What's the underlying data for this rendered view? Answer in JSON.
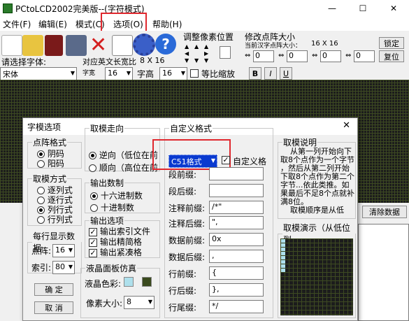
{
  "app": {
    "title": "PCtoLCD2002完美版--(字符模式)",
    "minimize": "—",
    "maximize": "☐",
    "close": "✕"
  },
  "menu": {
    "file": "文件(F)",
    "edit": "编辑(E)",
    "mode": "模式(C)",
    "options": "选项(O)",
    "help": "帮助(H)"
  },
  "toolbar": {
    "adjust_pixel": "调整像素位置",
    "resize_title": "修改点阵大小",
    "resize_sub": "当前汉字点阵大小：",
    "resize_size": "16  X  16",
    "lock": "锁定",
    "restore": "复位",
    "spin_a": "0",
    "spin_b": "0",
    "spin_c": "0",
    "spin_d": "0",
    "font_label": "请选择字体:",
    "font_value": "宋体",
    "en_width_label": "对应英文长宽比",
    "en_width_value": "8 X 16",
    "char_width_label": "字宽",
    "char_width_value": "16",
    "char_height_label": "字高",
    "char_height_value": "16",
    "ratio_label": "等比缩放",
    "bold": "B",
    "italic": "I",
    "underline": "U"
  },
  "right_panel": {
    "side_text": "",
    "clear_data": "清除数据"
  },
  "dialog": {
    "title": "字模选项",
    "close": "✕",
    "dot_format": {
      "legend": "点阵格式",
      "options": [
        "阴码",
        "阳码"
      ],
      "selected": 0
    },
    "mode_format": {
      "legend": "取模方式",
      "options": [
        "逐列式",
        "逐行式",
        "列行式",
        "行列式"
      ],
      "selected": 2
    },
    "per_row": {
      "legend": "每行显示数据",
      "dot_label": "点阵:",
      "dot_value": "16",
      "index_label": "索引:",
      "index_value": "80"
    },
    "ok": "确    定",
    "cancel": "取    消",
    "direction": {
      "legend": "取模走向",
      "options": [
        "逆向（低位在前",
        "顺向（高位在前"
      ],
      "selected": 0
    },
    "radix": {
      "legend": "输出数制",
      "options": [
        "十六进制数",
        "十进制数"
      ],
      "selected": 0
    },
    "output": {
      "legend": "输出选项",
      "options": [
        "输出索引文件",
        "输出精简格",
        "输出紧凑格"
      ],
      "checked": [
        true,
        true,
        true
      ]
    },
    "lcd": {
      "legend": "液晶面板仿真",
      "color_label": "液晶色彩:",
      "pixel_label": "像素大小:",
      "pixel_value": "8",
      "color_light": "#aee0ec",
      "color_dark": "#3a4a1e"
    },
    "custom": {
      "legend": "自定义格式",
      "format_value": "C51格式",
      "custom_check": "自定义格",
      "rows": [
        {
          "label": "段前缀:",
          "value": ""
        },
        {
          "label": "段后缀:",
          "value": ""
        },
        {
          "label": "注释前缀:",
          "value": "/*\""
        },
        {
          "label": "注释后缀:",
          "value": "\","
        },
        {
          "label": "数据前缀:",
          "value": "0x"
        },
        {
          "label": "数据后缀:",
          "value": ","
        },
        {
          "label": "行前缀:",
          "value": "{"
        },
        {
          "label": "行后缀:",
          "value": "},"
        },
        {
          "label": "行尾缀:",
          "value": "*/"
        }
      ]
    },
    "explain": {
      "legend": "取模说明",
      "text": [
        "从第一列开始向下",
        "取8个点作为一个字节",
        "，然后从第二列开始",
        "下取8个点作为第二个",
        "字节...依此类推。如",
        "果最后不足8个点就补",
        "满8位。",
        "取模顺序是从低"
      ]
    },
    "demo": {
      "legend": "取模演示（从低位到"
    }
  }
}
